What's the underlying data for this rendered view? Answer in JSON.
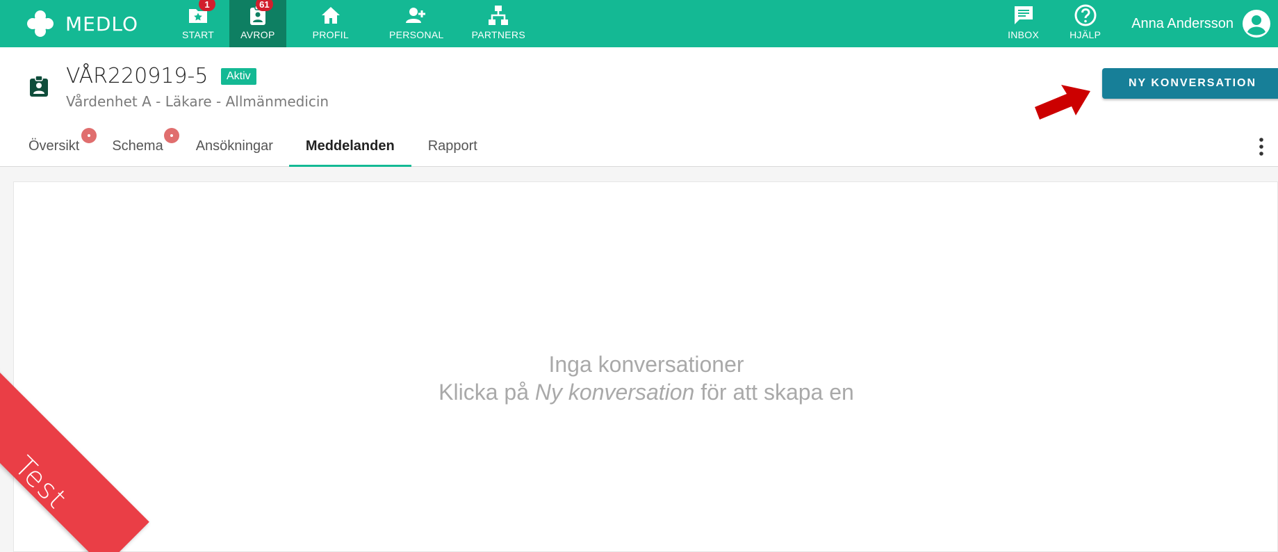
{
  "brand": {
    "name": "MEDLO",
    "color": "#14b994"
  },
  "nav": {
    "items": [
      {
        "label": "START",
        "icon": "folder-star-icon",
        "badge": "1"
      },
      {
        "label": "AVROP",
        "icon": "clipboard-person-icon",
        "badge": "61",
        "active": true
      },
      {
        "label": "PROFIL",
        "icon": "home-icon"
      },
      {
        "label": "PERSONAL",
        "icon": "person-add-icon"
      },
      {
        "label": "PARTNERS",
        "icon": "hierarchy-icon"
      }
    ],
    "right": [
      {
        "label": "INBOX",
        "icon": "message-icon"
      },
      {
        "label": "HJÄLP",
        "icon": "help-icon"
      }
    ],
    "user_name": "Anna Andersson"
  },
  "header": {
    "title": "VÅR220919-5",
    "status": "Aktiv",
    "subtitle": "Vårdenhet A - Läkare - Allmänmedicin",
    "new_button": "NY KONVERSATION"
  },
  "tabs": [
    {
      "label": "Översikt",
      "dot": true
    },
    {
      "label": "Schema",
      "dot": true
    },
    {
      "label": "Ansökningar"
    },
    {
      "label": "Meddelanden",
      "active": true
    },
    {
      "label": "Rapport"
    }
  ],
  "empty_state": {
    "line1": "Inga konversationer",
    "line2_prefix": "Klicka på",
    "line2_emphasis": "Ny konversation",
    "line2_suffix": "för att skapa en"
  },
  "ribbon": {
    "label": "Test",
    "color": "#ea3e46"
  },
  "colors": {
    "accent": "#14b994",
    "button": "#177f98",
    "badge": "#d11f2d",
    "arrow": "#cc0000"
  }
}
